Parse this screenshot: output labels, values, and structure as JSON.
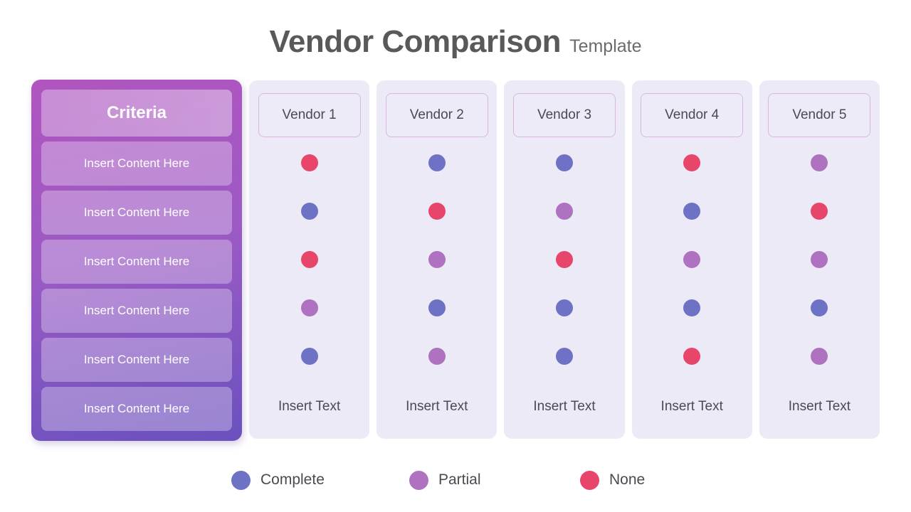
{
  "title": {
    "main": "Vendor Comparison",
    "sub": "Template"
  },
  "criteria_panel": {
    "header_label": "Criteria",
    "rows": [
      {
        "label": "Insert Content Here"
      },
      {
        "label": "Insert Content Here"
      },
      {
        "label": "Insert Content Here"
      },
      {
        "label": "Insert Content Here"
      },
      {
        "label": "Insert Content Here"
      },
      {
        "label": "Insert Content Here"
      }
    ]
  },
  "colors": {
    "complete": "#6e72c4",
    "partial": "#af72c0",
    "none": "#e8456a",
    "column_bg": "#edeaf7",
    "panel_top": "#b155c0",
    "panel_bottom": "#6a51be",
    "text": "#4a4a52",
    "title": "#595959"
  },
  "vendors": [
    {
      "name": "Vendor 1",
      "footer": "Insert Text",
      "statuses": [
        "none",
        "complete",
        "none",
        "partial",
        "complete"
      ]
    },
    {
      "name": "Vendor 2",
      "footer": "Insert Text",
      "statuses": [
        "complete",
        "none",
        "partial",
        "complete",
        "partial"
      ]
    },
    {
      "name": "Vendor 3",
      "footer": "Insert Text",
      "statuses": [
        "complete",
        "partial",
        "none",
        "complete",
        "complete"
      ]
    },
    {
      "name": "Vendor 4",
      "footer": "Insert Text",
      "statuses": [
        "none",
        "complete",
        "partial",
        "complete",
        "none"
      ]
    },
    {
      "name": "Vendor 5",
      "footer": "Insert Text",
      "statuses": [
        "partial",
        "none",
        "partial",
        "complete",
        "partial"
      ]
    }
  ],
  "legend": [
    {
      "label": "Complete",
      "status": "complete"
    },
    {
      "label": "Partial",
      "status": "partial"
    },
    {
      "label": "None",
      "status": "none"
    }
  ]
}
